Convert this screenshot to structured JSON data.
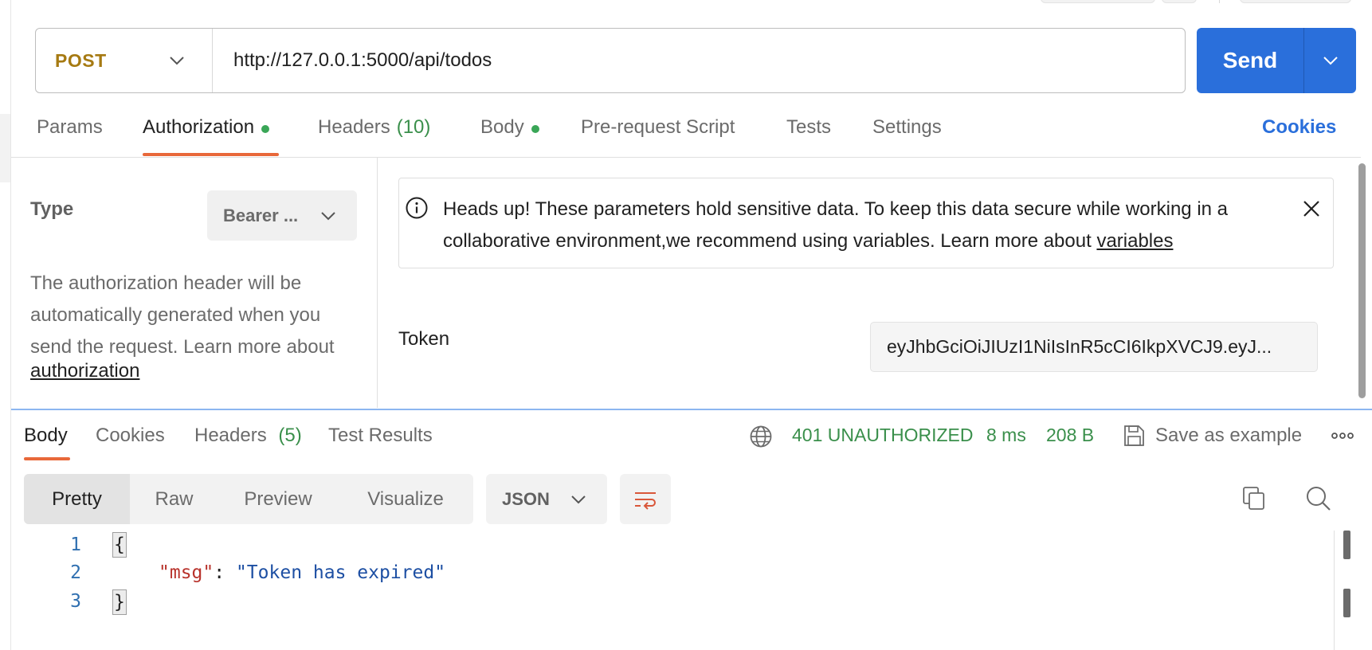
{
  "request": {
    "method": "POST",
    "url": "http://127.0.0.1:5000/api/todos",
    "send_label": "Send",
    "tabs": [
      {
        "label": "Params"
      },
      {
        "label": "Authorization"
      },
      {
        "label": "Headers",
        "count": "(10)"
      },
      {
        "label": "Body"
      },
      {
        "label": "Pre-request Script"
      },
      {
        "label": "Tests"
      },
      {
        "label": "Settings"
      }
    ],
    "cookies_label": "Cookies"
  },
  "auth": {
    "type_label": "Type",
    "type_value": "Bearer ...",
    "description": "The authorization header will be automatically generated when you send the request. Learn more about",
    "description_link": "authorization",
    "headsup_text": "Heads up! These parameters hold sensitive data. To keep this data secure while working in a collaborative environment,we recommend using variables. Learn more about",
    "headsup_link": "variables",
    "token_label": "Token",
    "token_value": "eyJhbGciOiJIUzI1NiIsInR5cCI6IkpXVCJ9.eyJ..."
  },
  "response": {
    "tabs": [
      {
        "label": "Body"
      },
      {
        "label": "Cookies"
      },
      {
        "label": "Headers",
        "count": "(5)"
      },
      {
        "label": "Test Results"
      }
    ],
    "status": "401 UNAUTHORIZED",
    "time": "8 ms",
    "size": "208 B",
    "save_label": "Save as example",
    "view_modes": [
      "Pretty",
      "Raw",
      "Preview",
      "Visualize"
    ],
    "format": "JSON",
    "lines": {
      "n1": "1",
      "n2": "2",
      "n3": "3",
      "open": "{",
      "key": "\"msg\"",
      "colon": ": ",
      "value": "\"Token has expired\"",
      "close": "}"
    }
  },
  "colors": {
    "accent": "#2a6fdb",
    "method": "#a67a12",
    "status_ok_green": "#3a8f4b",
    "tab_underline": "#e8683a",
    "json_key": "#b8322b",
    "json_string": "#1d4fa3"
  },
  "icons": [
    "chevron-down-icon",
    "info-icon",
    "close-icon",
    "globe-icon",
    "save-icon",
    "more-icon",
    "wrap-icon",
    "copy-icon",
    "search-icon"
  ]
}
